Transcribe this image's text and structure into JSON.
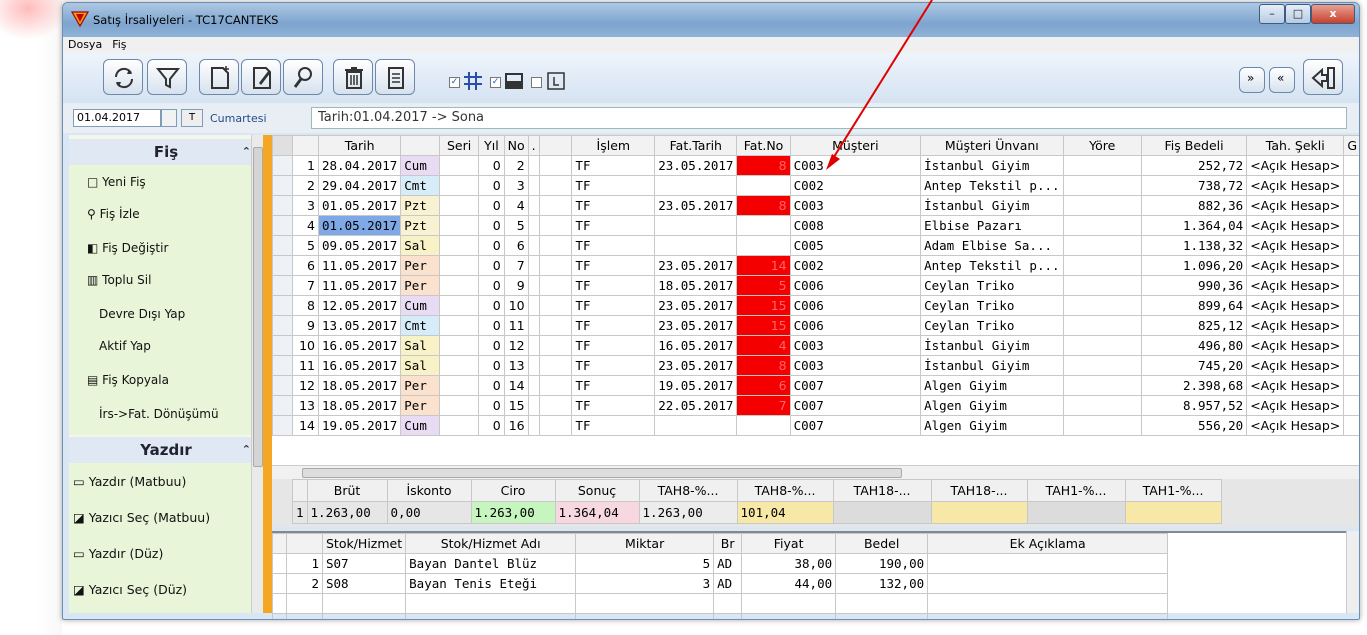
{
  "window": {
    "title": "Satış İrsaliyeleri - TC17CANTEKS",
    "min": "–",
    "max": "□",
    "close": "x"
  },
  "menu": [
    "Dosya",
    "Fiş"
  ],
  "toolbar": {
    "icons": [
      "refresh-icon",
      "filter-icon",
      "new-doc-icon",
      "edit-doc-icon",
      "search-icon",
      "delete-icon",
      "copy-icon",
      "grid-icon",
      "panel-icon",
      "label-icon",
      "expand-all-icon",
      "collapse-all-icon",
      "exit-icon"
    ]
  },
  "datebar": {
    "date": "01.04.2017",
    "t_button": "T",
    "day": "Cumartesi",
    "range": "Tarih:01.04.2017 -> Sona"
  },
  "sidebar": {
    "fis_header": "Fiş",
    "items": [
      "Yeni Fiş",
      "Fiş İzle",
      "Fiş Değiştir",
      "Toplu Sil",
      "Devre Dışı Yap",
      "Aktif Yap",
      "Fiş Kopyala",
      "İrs->Fat. Dönüşümü"
    ],
    "yazdir_header": "Yazdır",
    "print_items": [
      "Yazdır (Matbuu)",
      "Yazıcı Seç (Matbuu)",
      "Yazdır (Düz)",
      "Yazıcı Seç (Düz)"
    ]
  },
  "grid": {
    "columns": [
      "",
      "Tarih",
      "",
      "Seri",
      "Yıl",
      "No",
      ".",
      "İşlem",
      "Fat.Tarih",
      "Fat.No",
      "Müşteri",
      "Müşteri Ünvanı",
      "Yöre",
      "Fiş Bedeli",
      "Tah. Şekli",
      "G"
    ],
    "rows": [
      [
        "1",
        "28.04.2017",
        "Cum",
        "",
        "0",
        "2",
        "",
        "TF",
        "23.05.2017",
        "8",
        "C003",
        "İstanbul Giyim",
        "",
        "252,72",
        "<Açık Hesap>"
      ],
      [
        "2",
        "29.04.2017",
        "Cmt",
        "",
        "0",
        "3",
        "",
        "TF",
        "",
        "",
        "C002",
        "Antep Tekstil p...",
        "",
        "738,72",
        "<Açık Hesap>"
      ],
      [
        "3",
        "01.05.2017",
        "Pzt",
        "",
        "0",
        "4",
        "",
        "TF",
        "23.05.2017",
        "8",
        "C003",
        "İstanbul Giyim",
        "",
        "882,36",
        "<Açık Hesap>"
      ],
      [
        "4",
        "01.05.2017",
        "Pzt",
        "",
        "0",
        "5",
        "",
        "TF",
        "",
        "",
        "C008",
        "Elbise Pazarı",
        "",
        "1.364,04",
        "<Açık Hesap>"
      ],
      [
        "5",
        "09.05.2017",
        "Sal",
        "",
        "0",
        "6",
        "",
        "TF",
        "",
        "",
        "C005",
        "Adam Elbise Sa...",
        "",
        "1.138,32",
        "<Açık Hesap>"
      ],
      [
        "6",
        "11.05.2017",
        "Per",
        "",
        "0",
        "7",
        "",
        "TF",
        "23.05.2017",
        "14",
        "C002",
        "Antep Tekstil p...",
        "",
        "1.096,20",
        "<Açık Hesap>"
      ],
      [
        "7",
        "11.05.2017",
        "Per",
        "",
        "0",
        "9",
        "",
        "TF",
        "18.05.2017",
        "5",
        "C006",
        "Ceylan Triko",
        "",
        "990,36",
        "<Açık Hesap>"
      ],
      [
        "8",
        "12.05.2017",
        "Cum",
        "",
        "0",
        "10",
        "",
        "TF",
        "23.05.2017",
        "15",
        "C006",
        "Ceylan Triko",
        "",
        "899,64",
        "<Açık Hesap>"
      ],
      [
        "9",
        "13.05.2017",
        "Cmt",
        "",
        "0",
        "11",
        "",
        "TF",
        "23.05.2017",
        "15",
        "C006",
        "Ceylan Triko",
        "",
        "825,12",
        "<Açık Hesap>"
      ],
      [
        "10",
        "16.05.2017",
        "Sal",
        "",
        "0",
        "12",
        "",
        "TF",
        "16.05.2017",
        "4",
        "C003",
        "İstanbul Giyim",
        "",
        "496,80",
        "<Açık Hesap>"
      ],
      [
        "11",
        "16.05.2017",
        "Sal",
        "",
        "0",
        "13",
        "",
        "TF",
        "23.05.2017",
        "8",
        "C003",
        "İstanbul Giyim",
        "",
        "745,20",
        "<Açık Hesap>"
      ],
      [
        "12",
        "18.05.2017",
        "Per",
        "",
        "0",
        "14",
        "",
        "TF",
        "19.05.2017",
        "6",
        "C007",
        "Algen Giyim",
        "",
        "2.398,68",
        "<Açık Hesap>"
      ],
      [
        "13",
        "18.05.2017",
        "Per",
        "",
        "0",
        "15",
        "",
        "TF",
        "22.05.2017",
        "7",
        "C007",
        "Algen Giyim",
        "",
        "8.957,52",
        "<Açık Hesap>"
      ],
      [
        "14",
        "19.05.2017",
        "Cum",
        "",
        "0",
        "16",
        "",
        "TF",
        "",
        "",
        "C007",
        "Algen Giyim",
        "",
        "556,20",
        "<Açık Hesap>"
      ]
    ],
    "day_colors": {
      "Cum": "#e8dcf4",
      "Cmt": "#d6ecf9",
      "Pzt": "#f9f2d2",
      "Sal": "#f9f2c6",
      "Per": "#fbe2cf"
    },
    "selected_row_color": "#7fa8e6",
    "fat_no_color": "#f40000"
  },
  "totals": {
    "columns": [
      "",
      "Brüt",
      "İskonto",
      "Ciro",
      "Sonuç",
      "TAH8-%...",
      "TAH8-%...",
      "TAH18-...",
      "TAH18-...",
      "TAH1-%...",
      "TAH1-%..."
    ],
    "row": [
      "1",
      "1.263,00",
      "0,00",
      "1.263,00",
      "1.364,04",
      "1.263,00",
      "101,04",
      "",
      "",
      "",
      ""
    ]
  },
  "detail": {
    "columns": [
      "",
      "",
      "Stok/Hizmet",
      "Stok/Hizmet Adı",
      "Miktar",
      "Br",
      "Fiyat",
      "Bedel",
      "Ek Açıklama"
    ],
    "rows": [
      [
        "",
        "1",
        "S07",
        "Bayan Dantel Blüz",
        "5",
        "AD",
        "38,00",
        "190,00",
        ""
      ],
      [
        "",
        "2",
        "S08",
        "Bayan Tenis Eteği",
        "3",
        "AD",
        "44,00",
        "132,00",
        ""
      ]
    ]
  },
  "annotation_color": "#e00000"
}
